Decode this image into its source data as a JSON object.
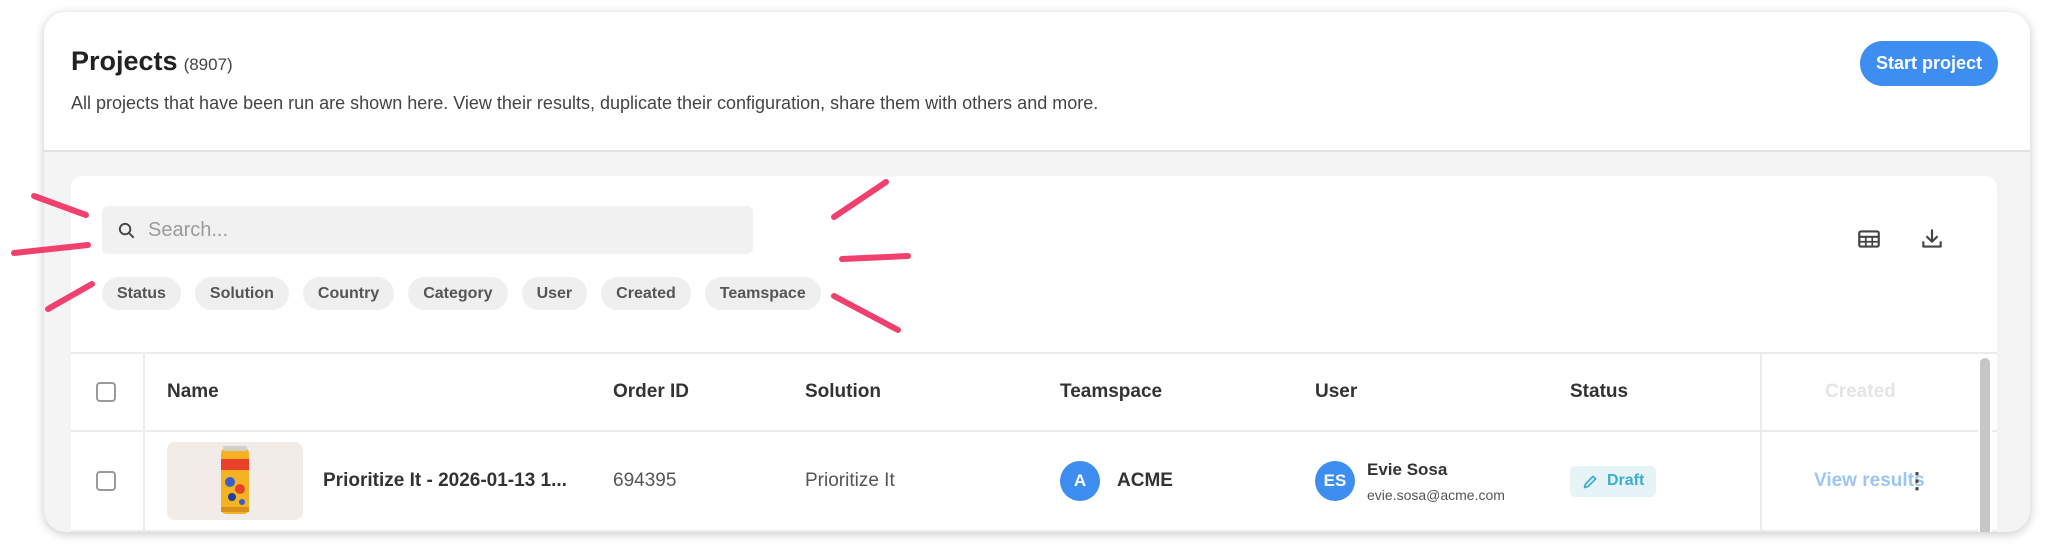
{
  "header": {
    "title": "Projects",
    "count": "(8907)",
    "subtitle": "All projects that have been run are shown here. View their results, duplicate their configuration, share them with others and more.",
    "start_button": "Start project"
  },
  "search": {
    "placeholder": "Search..."
  },
  "filters": [
    "Status",
    "Solution",
    "Country",
    "Category",
    "User",
    "Created",
    "Teamspace"
  ],
  "toolbar": {
    "icons": [
      "table-view-icon",
      "download-icon"
    ]
  },
  "table": {
    "columns": [
      "Name",
      "Order ID",
      "Solution",
      "Teamspace",
      "User",
      "Status",
      "Created"
    ],
    "rows": [
      {
        "name": "Prioritize It - 2026-01-13 1...",
        "order_id": "694395",
        "solution": "Prioritize It",
        "teamspace_initial": "A",
        "teamspace": "ACME",
        "user_initials": "ES",
        "user_name": "Evie Sosa",
        "user_email": "evie.sosa@acme.com",
        "status": "Draft",
        "action": "View results"
      }
    ]
  },
  "colors": {
    "accent": "#3d8ef0",
    "draft_badge_text": "#39aecf",
    "draft_badge_bg": "#e7f4f7",
    "annotation_marks": "#f0416e"
  }
}
